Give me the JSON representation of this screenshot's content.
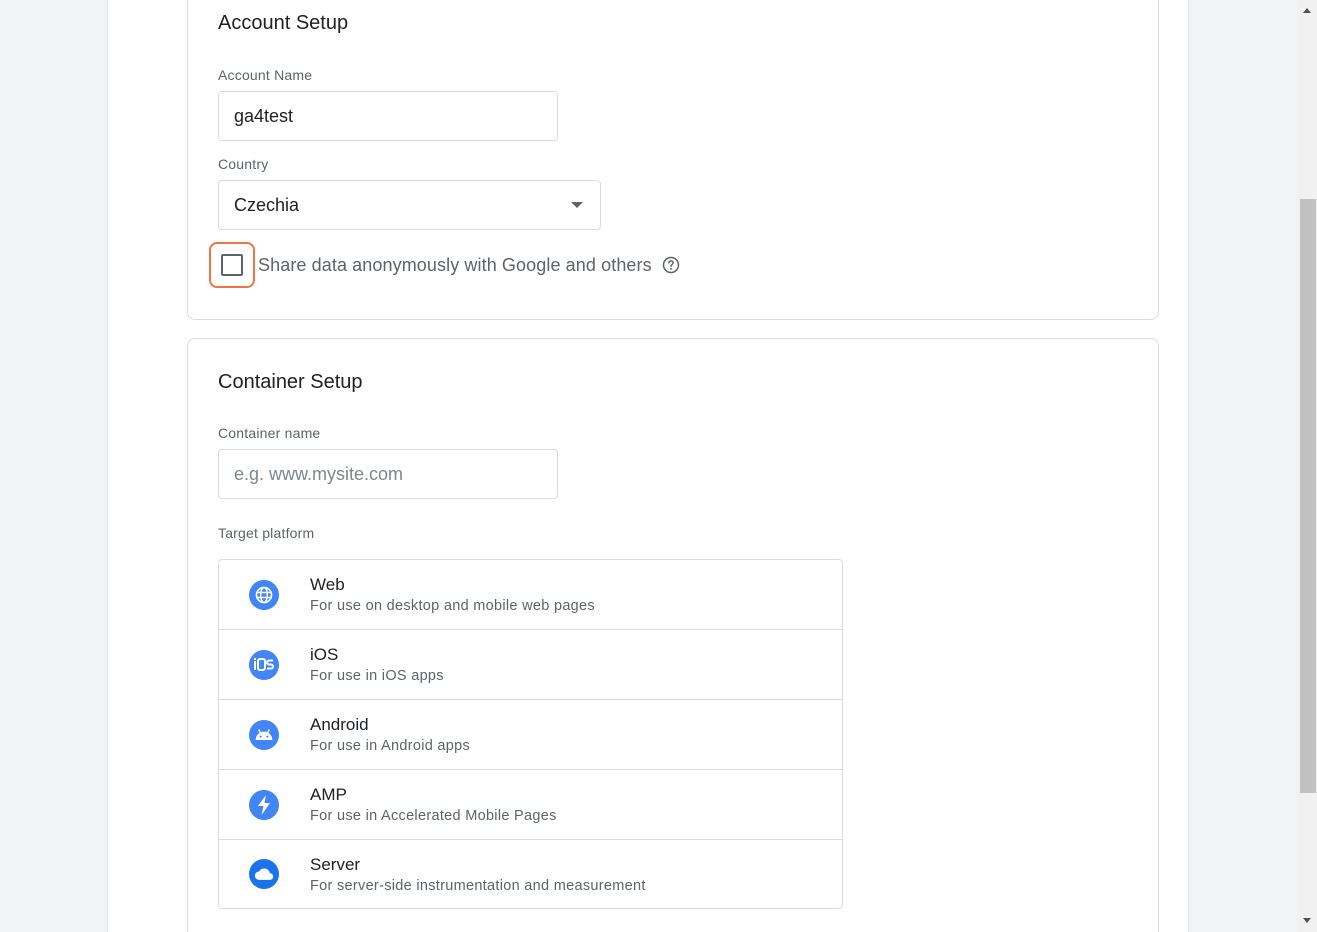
{
  "account_setup": {
    "title": "Account Setup",
    "account_name_label": "Account Name",
    "account_name_value": "ga4test",
    "country_label": "Country",
    "country_value": "Czechia",
    "share_data_label": "Share data anonymously with Google and others",
    "share_data_checked": false
  },
  "container_setup": {
    "title": "Container Setup",
    "container_name_label": "Container name",
    "container_name_placeholder": "e.g. www.mysite.com",
    "container_name_value": "",
    "target_platform_label": "Target platform",
    "platforms": [
      {
        "name": "Web",
        "description": "For use on desktop and mobile web pages",
        "icon": "globe-icon"
      },
      {
        "name": "iOS",
        "description": "For use in iOS apps",
        "icon": "ios-icon"
      },
      {
        "name": "Android",
        "description": "For use in Android apps",
        "icon": "android-icon"
      },
      {
        "name": "AMP",
        "description": "For use in Accelerated Mobile Pages",
        "icon": "lightning-icon"
      },
      {
        "name": "Server",
        "description": "For server-side instrumentation and measurement",
        "icon": "cloud-icon"
      }
    ]
  },
  "colors": {
    "accent_blue": "#4285f4",
    "focus_outline": "#f07545"
  }
}
